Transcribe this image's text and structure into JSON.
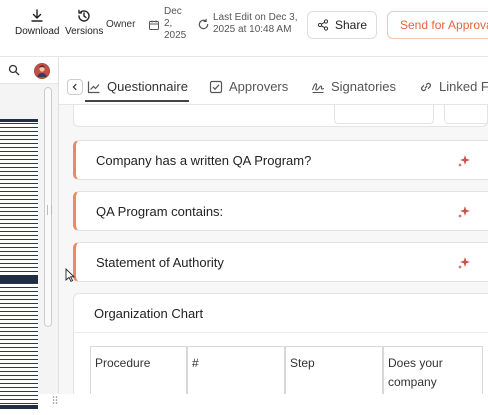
{
  "toolbar": {
    "download_label": "Download",
    "versions_label": "Versions",
    "owner_label": "Owner",
    "date_lines": [
      "Dec",
      "2,",
      "2025"
    ],
    "last_edit_lines": [
      "Last Edit on Dec 3,",
      "2025 at 10:48 AM"
    ],
    "share_label": "Share",
    "send_approval_label": "Send for Approval"
  },
  "tabs": [
    {
      "label": "Questionnaire",
      "icon": "chart-icon",
      "active": true
    },
    {
      "label": "Approvers",
      "icon": "checkbox-icon",
      "active": false
    },
    {
      "label": "Signatories",
      "icon": "signature-icon",
      "active": false
    },
    {
      "label": "Linked Fi",
      "icon": "link-icon",
      "active": false
    }
  ],
  "sections": [
    {
      "title": "Company has a written QA Program?"
    },
    {
      "title": "QA Program contains:"
    },
    {
      "title": "Statement of Authority"
    }
  ],
  "org_chart": {
    "title": "Organization Chart",
    "columns": [
      "Procedure",
      "#",
      "Step",
      "Does your company"
    ]
  },
  "more_glyph": "⋮",
  "colors": {
    "accent": "#e98a5f",
    "approval_text": "#e0673d",
    "approval_border": "#f1c4b6",
    "sparkle": "#c9524a"
  }
}
